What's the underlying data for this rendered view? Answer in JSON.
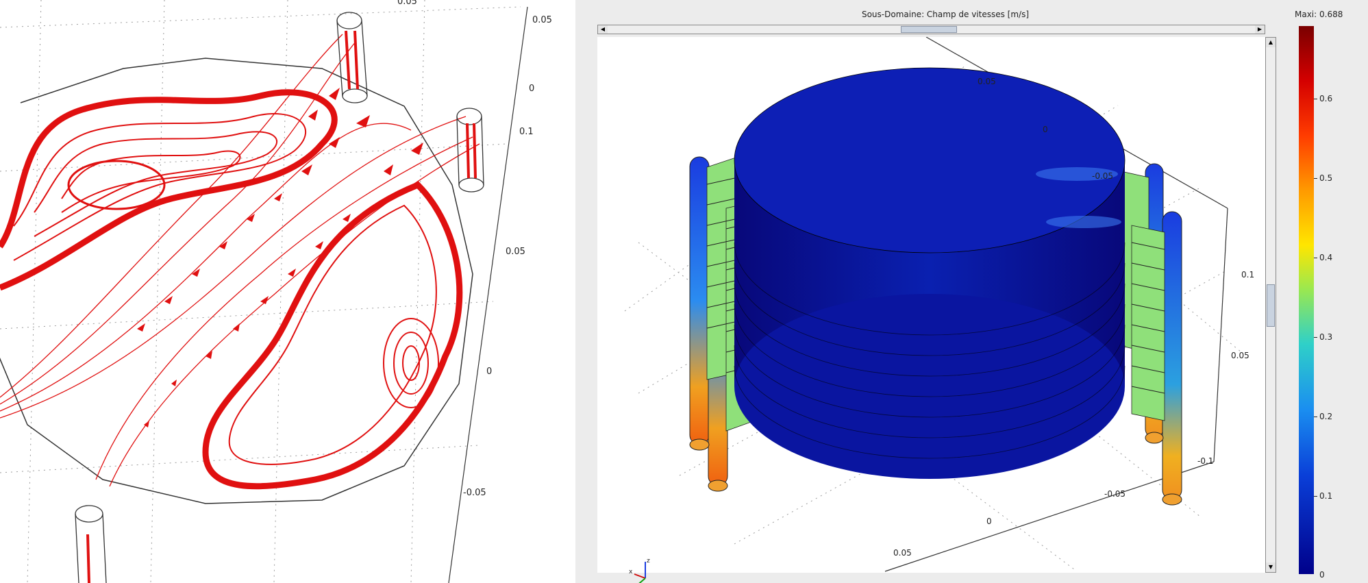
{
  "left_view": {
    "axis_ticks": [
      "0.05",
      "0",
      "0.1",
      "0.05",
      "0",
      "-0.05"
    ],
    "top_partial_tick": "0.05"
  },
  "right_view": {
    "title": "Sous-Domaine: Champ de vitesses [m/s]",
    "scrollbar": {
      "left_arrow": "◀",
      "right_arrow": "▶",
      "up_arrow": "▲",
      "down_arrow": "▼",
      "grip": "||"
    },
    "axis_ticks_top": [
      "0.05",
      "0",
      "-0.05"
    ],
    "axis_ticks_side": [
      "0.1",
      "0.05"
    ],
    "axis_ticks_bottom": [
      "-0.1",
      "-0.05",
      "0",
      "0.05"
    ],
    "axes_labels": {
      "x": "x",
      "y": "y",
      "z": "z"
    },
    "colorbar": {
      "max_label": "Maxi: 0.688",
      "ticks": [
        "0.6",
        "0.5",
        "0.4",
        "0.3",
        "0.2",
        "0.1",
        "0"
      ]
    }
  },
  "colors": {
    "streamline": "#e01010",
    "background": "#ffffff",
    "panel_bg": "#ececec"
  }
}
